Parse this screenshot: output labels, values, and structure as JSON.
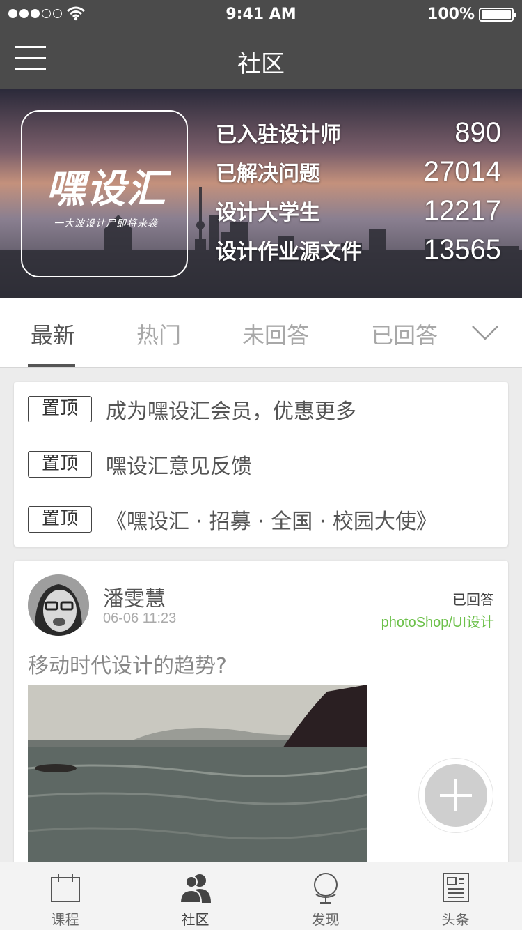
{
  "status_bar": {
    "time": "9:41 AM",
    "battery": "100%"
  },
  "nav": {
    "title": "社区"
  },
  "banner": {
    "logo": {
      "text": "嘿设汇",
      "subtitle": "一大波设计尸即将来袭"
    },
    "stats": [
      {
        "label": "已入驻设计师",
        "value": "890"
      },
      {
        "label": "已解决问题",
        "value": "27014"
      },
      {
        "label": "设计大学生",
        "value": "12217"
      },
      {
        "label": "设计作业源文件",
        "value": "13565"
      }
    ]
  },
  "tabs": {
    "items": [
      "最新",
      "热门",
      "未回答",
      "已回答"
    ],
    "active": "最新"
  },
  "pinned": {
    "tag": "置顶",
    "items": [
      "成为嘿设汇会员，优惠更多",
      "嘿设汇意见反馈",
      "《嘿设汇 · 招募 · 全国 · 校园大使》"
    ]
  },
  "post": {
    "author": "潘雯慧",
    "time": "06-06  11:23",
    "status": "已回答",
    "category": "photoShop/UI设计",
    "question": "移动时代设计的趋势?"
  },
  "tabbar": {
    "items": [
      {
        "label": "课程",
        "icon": "calendar-icon"
      },
      {
        "label": "社区",
        "icon": "people-icon"
      },
      {
        "label": "发现",
        "icon": "globe-icon"
      },
      {
        "label": "头条",
        "icon": "newspaper-icon"
      }
    ],
    "active": "社区"
  },
  "colors": {
    "nav_bg": "#4b4b4b",
    "category_green": "#6cc04a"
  }
}
